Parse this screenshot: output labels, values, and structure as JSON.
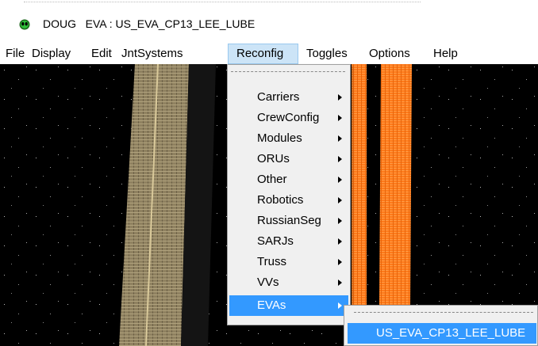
{
  "window": {
    "app_name": "DOUG",
    "title": "EVA : US_EVA_CP13_LEE_LUBE",
    "icon": "alien-head-icon"
  },
  "menubar": {
    "items": [
      {
        "label": "File"
      },
      {
        "label": "Display"
      },
      {
        "label": "Edit"
      },
      {
        "label": "JntSystems"
      },
      {
        "label": "Reconfig"
      },
      {
        "label": "Toggles"
      },
      {
        "label": "Options"
      },
      {
        "label": "Help"
      }
    ],
    "active": "Reconfig"
  },
  "reconfig_menu": {
    "items": [
      {
        "label": "Carriers"
      },
      {
        "label": "CrewConfig"
      },
      {
        "label": "Modules"
      },
      {
        "label": "ORUs"
      },
      {
        "label": "Other"
      },
      {
        "label": "Robotics"
      },
      {
        "label": "RussianSeg"
      },
      {
        "label": "SARJs"
      },
      {
        "label": "Truss"
      },
      {
        "label": "VVs"
      },
      {
        "label": "EVAs"
      }
    ],
    "selected": "EVAs"
  },
  "evas_submenu": {
    "items": [
      {
        "label": "US_EVA_CP13_LEE_LUBE"
      }
    ]
  },
  "colors": {
    "highlight": "#3399ff",
    "solar_array_orange": "#ff7a1a",
    "solar_array_tan": "#9a8a66",
    "space": "#000000"
  }
}
